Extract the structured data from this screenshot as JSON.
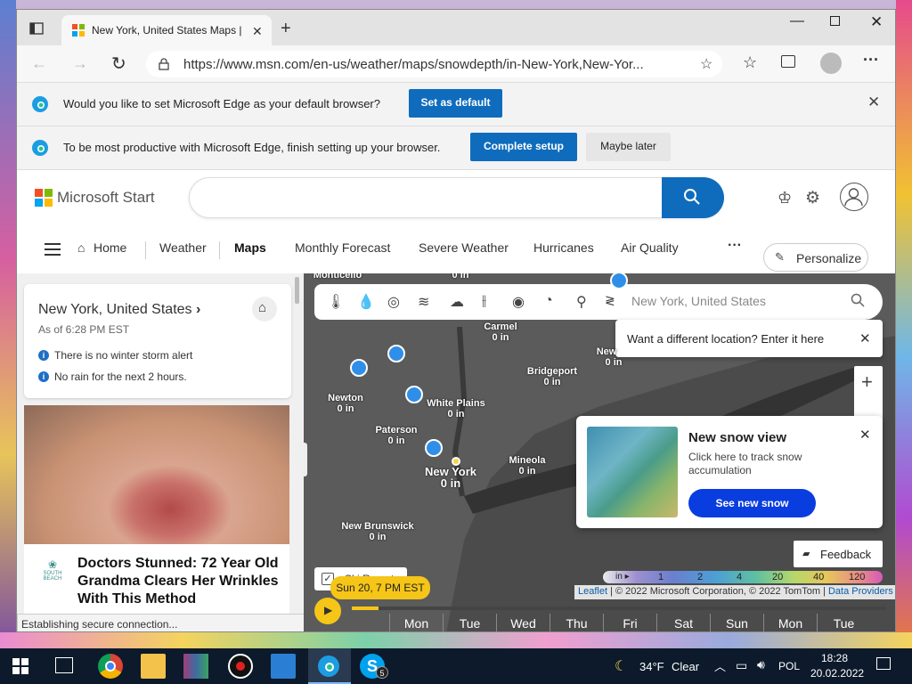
{
  "browser": {
    "tab_title": "New York, United States Maps | ",
    "url": "https://www.msn.com/en-us/weather/maps/snowdepth/in-New-York,New-Yor..."
  },
  "default_bar": {
    "message": "Would you like to set Microsoft Edge as your default browser?",
    "set_default_label": "Set as default"
  },
  "setup_bar": {
    "message": "To be most productive with Microsoft Edge, finish setting up your browser.",
    "complete_label": "Complete setup",
    "later_label": "Maybe later"
  },
  "msn": {
    "brand": "Microsoft Start",
    "nav": [
      "Home",
      "Weather",
      "Maps",
      "Monthly Forecast",
      "Severe Weather",
      "Hurricanes",
      "Air Quality"
    ],
    "more": "···",
    "personalize": "Personalize"
  },
  "location_card": {
    "title": "New York, United States",
    "as_of": "As of 6:28 PM EST",
    "alert1": "There is no winter storm alert",
    "alert2": "No rain for the next 2 hours."
  },
  "ad": {
    "brand": "SOUTH BEACH",
    "headline": "Doctors Stunned: 72 Year Old Grandma Clears Her Wrinkles With This Method"
  },
  "status_text": "Establishing secure connection...",
  "map": {
    "search_placeholder": "New York, United States",
    "tip": "Want a different location? Enter it here",
    "locations": [
      {
        "name": "Monticello",
        "value": "0 in"
      },
      {
        "name": "",
        "value": "0 in"
      },
      {
        "name": "Carmel",
        "value": "0 in"
      },
      {
        "name": "New",
        "value": "0 in"
      },
      {
        "name": "Bridgeport",
        "value": "0 in"
      },
      {
        "name": "Newton",
        "value": "0 in"
      },
      {
        "name": "White Plains",
        "value": "0 in"
      },
      {
        "name": "Paterson",
        "value": "0 in"
      },
      {
        "name": "New York",
        "value": "0 in"
      },
      {
        "name": "Mineola",
        "value": "0 in"
      },
      {
        "name": "New Brunswick",
        "value": "0 in"
      }
    ],
    "snow_card": {
      "title": "New snow view",
      "desc": "Click here to track snow accumulation",
      "button": "See new snow"
    },
    "feedback": "Feedback",
    "ski_resort": "Ski Resort",
    "legend_unit": "in",
    "legend_values": [
      "1",
      "2",
      "4",
      "20",
      "40",
      "120"
    ],
    "attribution_leaflet": "Leaflet",
    "attribution_text": " | © 2022 Microsoft Corporation, © 2022 TomTom | ",
    "attribution_providers": "Data Providers",
    "time_label": "Sun 20, 7 PM EST",
    "days": [
      "Mon",
      "Tue",
      "Wed",
      "Thu",
      "Fri",
      "Sat",
      "Sun",
      "Mon",
      "Tue"
    ]
  },
  "taskbar": {
    "temp": "34°F",
    "condition": "Clear",
    "lang": "POL",
    "time": "18:28",
    "date": "20.02.2022",
    "skype_badge": "5"
  },
  "colors": {
    "accent": "#0f6cbd",
    "map_bg": "#5a5a5a",
    "timeline": "#f5c518",
    "taskbar": "#0c1a2b"
  }
}
